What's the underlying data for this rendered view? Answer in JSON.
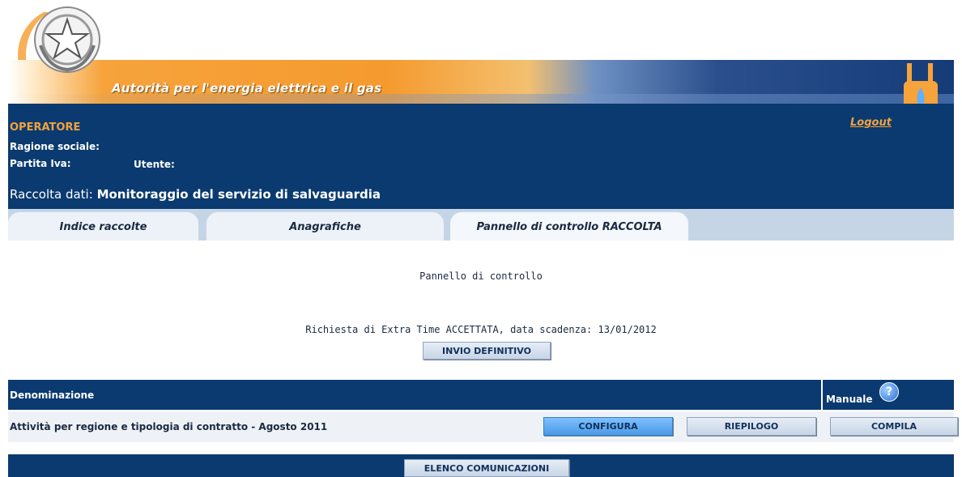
{
  "banner": {
    "title": "Autorità per l'energia elettrica e il gas"
  },
  "header": {
    "operator_heading": "OPERATORE",
    "ragione_sociale_label": "Ragione sociale:",
    "partita_iva_label": "Partita Iva:",
    "utente_label": "Utente:",
    "logout_label": "Logout",
    "raccolta_prefix": "Raccolta dati:",
    "raccolta_name": "Monitoraggio del servizio di salvaguardia"
  },
  "tabs": [
    {
      "label": "Indice raccolte"
    },
    {
      "label": "Anagrafiche"
    },
    {
      "label": "Pannello di controllo RACCOLTA"
    }
  ],
  "main": {
    "panel_title": "Pannello di controllo",
    "extra_time_status": "Richiesta di Extra Time ACCETTATA, data scadenza: 13/01/2012",
    "invio_button": "INVIO DEFINITIVO"
  },
  "table": {
    "col_denominazione": "Denominazione",
    "col_manuale": "Manuale",
    "help_symbol": "?",
    "rows": [
      {
        "name": "Attività per regione e tipologia di contratto - Agosto 2011",
        "configura": "CONFIGURA",
        "riepilogo": "RIEPILOGO",
        "compila": "COMPILA"
      }
    ]
  },
  "footer": {
    "elenco_button": "ELENCO COMUNICAZIONI"
  },
  "colors": {
    "navy": "#0a3a6f",
    "orange": "#f4a23b",
    "tab_bar": "#c6d5e6",
    "button_blue": "#4a9ae8"
  },
  "icons": {
    "emblem": "italian-republic-emblem-icon",
    "plug": "gas-plug-icon",
    "help": "help-icon"
  }
}
